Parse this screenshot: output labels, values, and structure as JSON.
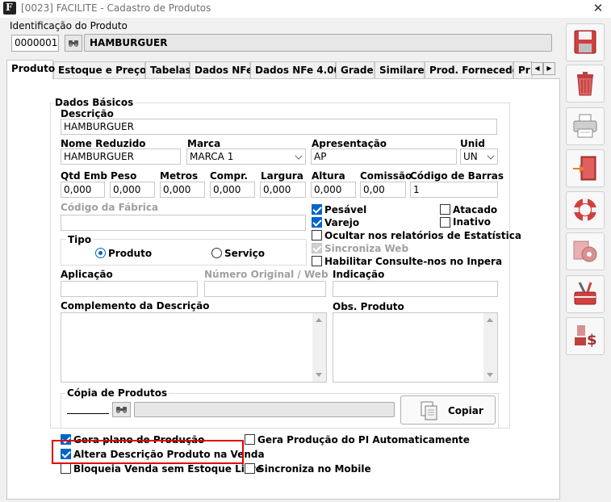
{
  "window": {
    "title": "[0023] FACILITE - Cadastro de Produtos",
    "icon": "app-f-icon",
    "close": "✕"
  },
  "identification": {
    "label": "Identificação do Produto",
    "code": "0000001",
    "name": "HAMBURGUER"
  },
  "tabs": [
    "Produto",
    "Estoque e Preços",
    "Tabelas",
    "Dados NFe",
    "Dados NFe 4.00",
    "Grade",
    "Similares",
    "Prod. Fornecedor",
    "Pr"
  ],
  "basic": {
    "group": "Dados Básicos",
    "descricao_label": "Descrição",
    "descricao": "HAMBURGUER",
    "nome_reduzido_label": "Nome Reduzido",
    "nome_reduzido": "HAMBURGUER",
    "marca_label": "Marca",
    "marca": "MARCA 1",
    "apresentacao_label": "Apresentação",
    "apresentacao": "AP",
    "unid_label": "Unid",
    "unid": "UN"
  },
  "measures": {
    "qtd_emb_label": "Qtd Emb",
    "qtd_emb": "0,000",
    "peso_label": "Peso",
    "peso": "0,000",
    "metros_label": "Metros",
    "metros": "0,000",
    "compr_label": "Compr.",
    "compr": "0,000",
    "largura_label": "Largura",
    "largura": "0,000",
    "altura_label": "Altura",
    "altura": "0,000",
    "comissao_label": "Comissão",
    "comissao": "0,00",
    "codigo_barras_label": "Código de Barras",
    "codigo_barras": "1"
  },
  "codigo_fabrica_label": "Código da Fábrica",
  "flags": {
    "pesavel": "Pesável",
    "atacado": "Atacado",
    "varejo": "Varejo",
    "inativo": "Inativo",
    "ocultar": "Ocultar nos relatórios de Estatística",
    "sincroniza_web": "Sincroniza Web",
    "consulte": "Habilitar Consulte-nos no Inpera"
  },
  "tipo": {
    "label": "Tipo",
    "produto": "Produto",
    "servico": "Serviço"
  },
  "aplicacao_label": "Aplicação",
  "numero_original_label": "Número Original / Web",
  "indicacao_label": "Indicação",
  "complemento_label": "Complemento da Descrição",
  "obs_label": "Obs. Produto",
  "copia": {
    "label": "Cópia de Produtos",
    "button": "Copiar"
  },
  "options": {
    "gera_plano": "Gera plano de Produção",
    "gera_producao_pi": "Gera Produção do PI Automaticamente",
    "altera_descricao": "Altera Descrição Produto na Venda",
    "bloqueia_venda": "Bloqueia Venda sem Estoque Livre",
    "sincroniza_mobile": "Sincroniza no Mobile"
  },
  "accent_color": "#0064c8",
  "highlight_color": "#e00000",
  "side_icons": [
    "save-icon",
    "trash-icon",
    "printer-icon",
    "exit-door-icon",
    "lifebuoy-help-icon",
    "settings-gear-icon",
    "toolbox-icon",
    "price-money-icon"
  ]
}
